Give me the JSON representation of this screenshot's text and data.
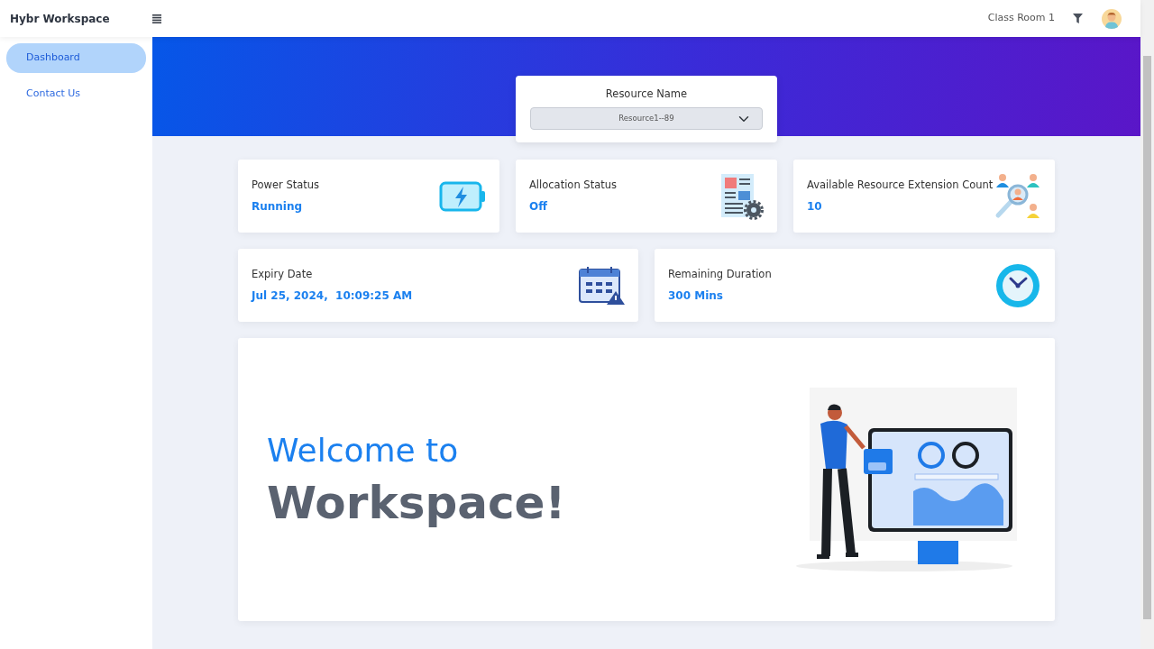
{
  "navbar": {
    "brand": "Hybr Workspace",
    "location": "Class Room 1"
  },
  "sidebar": {
    "items": [
      {
        "label": "Dashboard",
        "selected": true
      },
      {
        "label": "Contact Us",
        "selected": false
      }
    ]
  },
  "resource": {
    "label": "Resource Name",
    "value": "Resource1--89"
  },
  "stat_rows": [
    [
      {
        "kind": "battery",
        "label": "Power Status",
        "value": "Running"
      },
      {
        "kind": "document",
        "label": "Allocation Status",
        "value": "Off"
      },
      {
        "kind": "people",
        "label": "Available Resource Extension Count",
        "value": "10"
      }
    ],
    [
      {
        "kind": "calendar",
        "label": "Expiry Date",
        "value": "Jul 25, 2024,  10:09:25 AM"
      },
      {
        "kind": "clock",
        "label": "Remaining Duration",
        "value": "300 Mins"
      }
    ]
  ],
  "welcome": {
    "line_1": "Welcome to",
    "line_2": "Workspace!"
  }
}
